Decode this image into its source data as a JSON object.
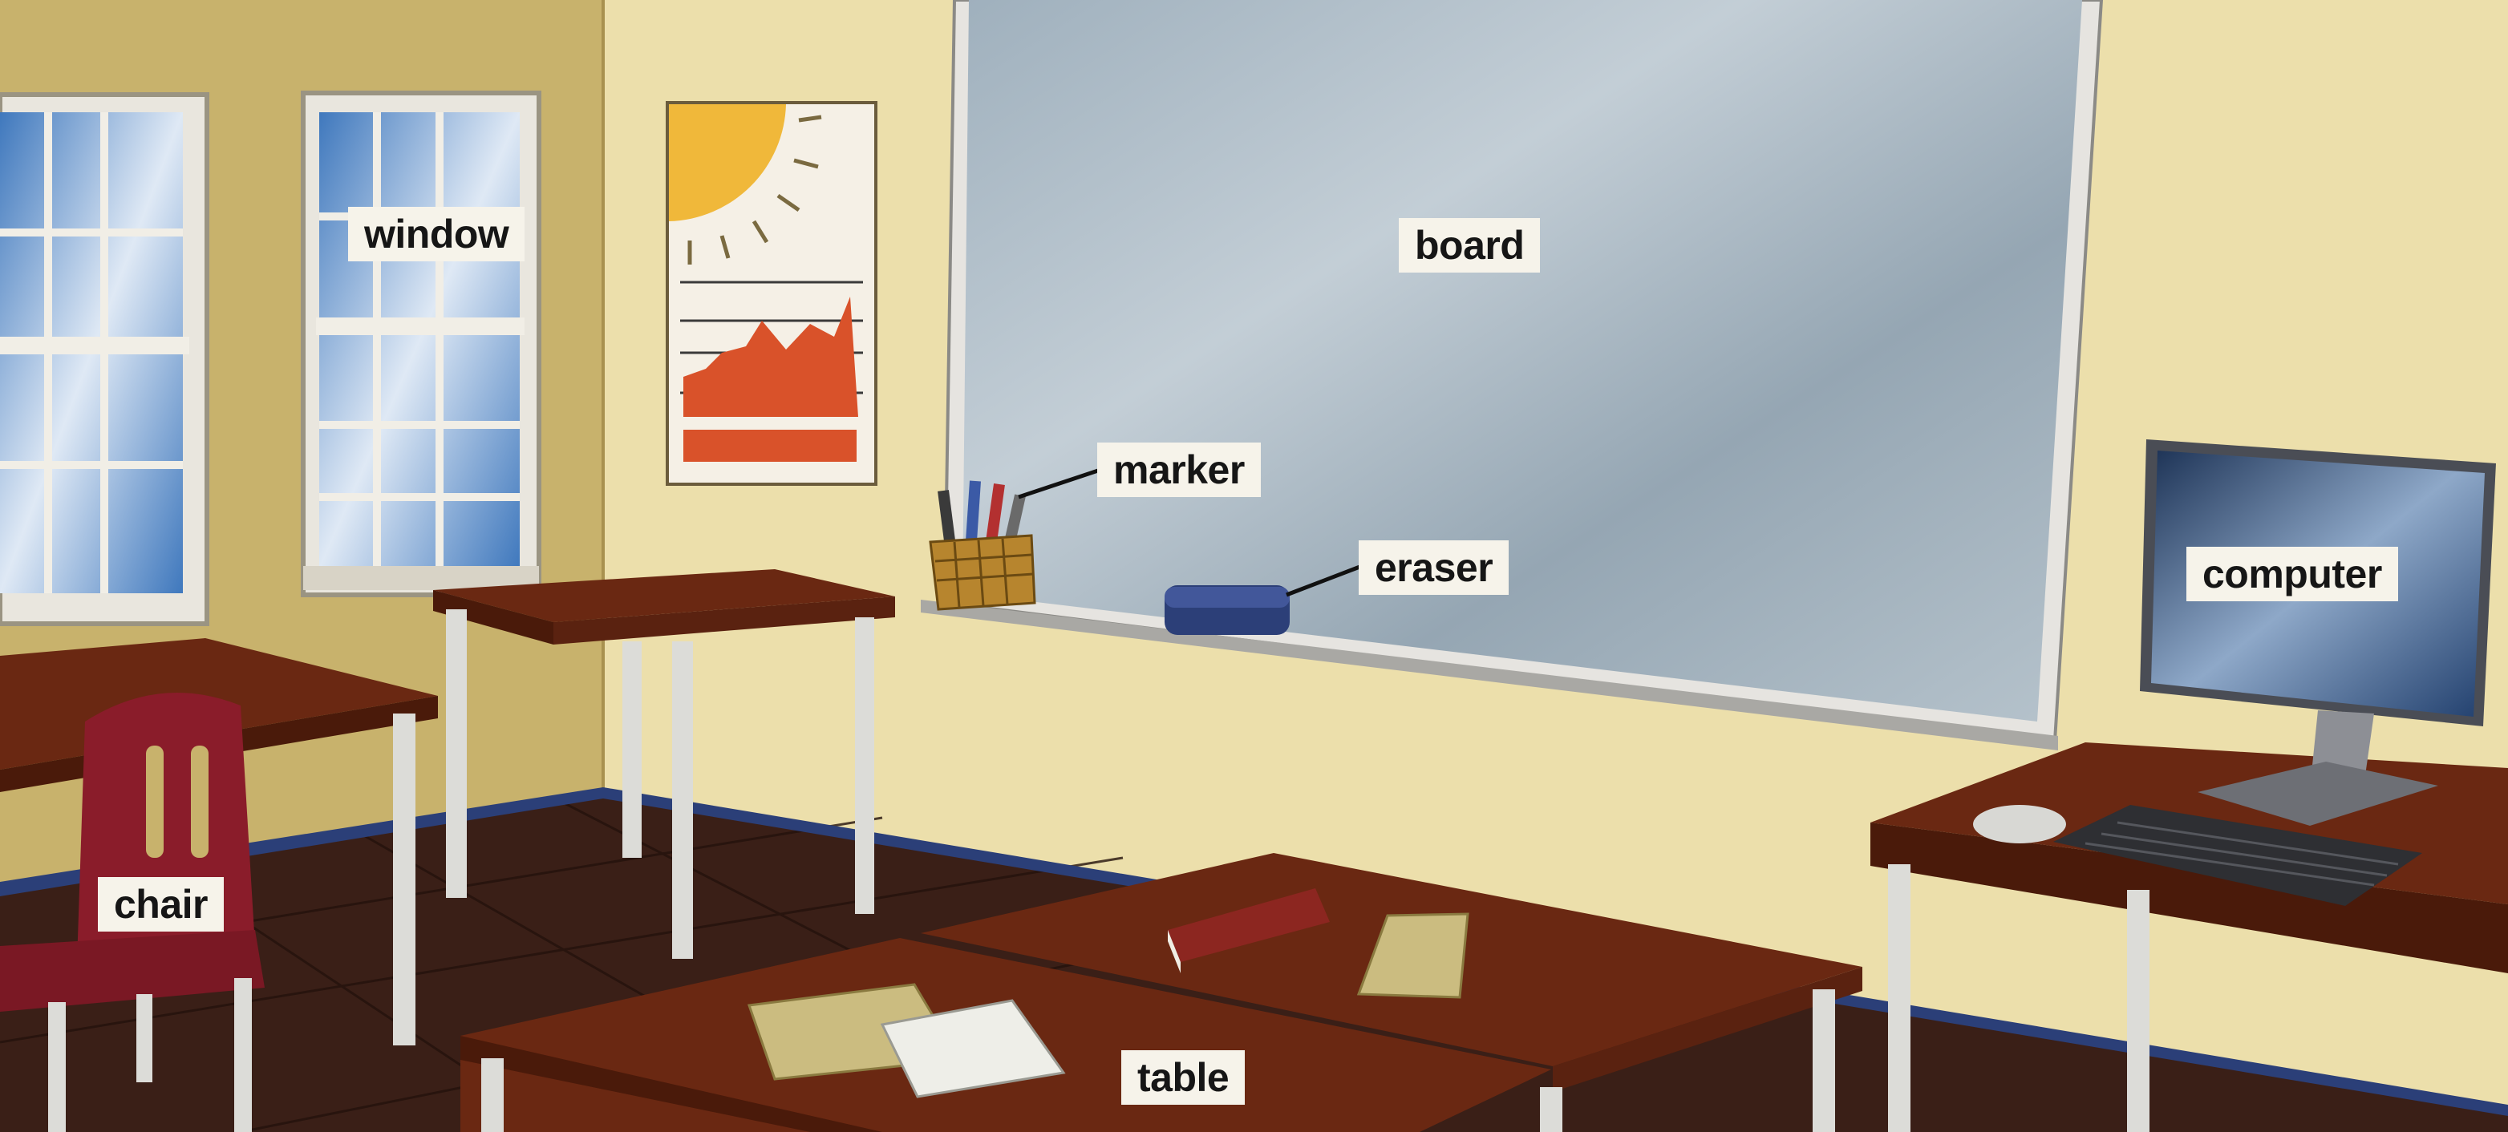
{
  "labels": {
    "window": "window",
    "board": "board",
    "marker": "marker",
    "eraser": "eraser",
    "computer": "computer",
    "chair": "chair",
    "table": "table"
  },
  "colors": {
    "wall_left": "#c8b26c",
    "wall_back": "#ecdfab",
    "board": "#a9b8c3",
    "floor": "#3a1f17",
    "wood": "#7a2e14",
    "chair": "#8a1c2a",
    "sky": "#4f86c6"
  }
}
